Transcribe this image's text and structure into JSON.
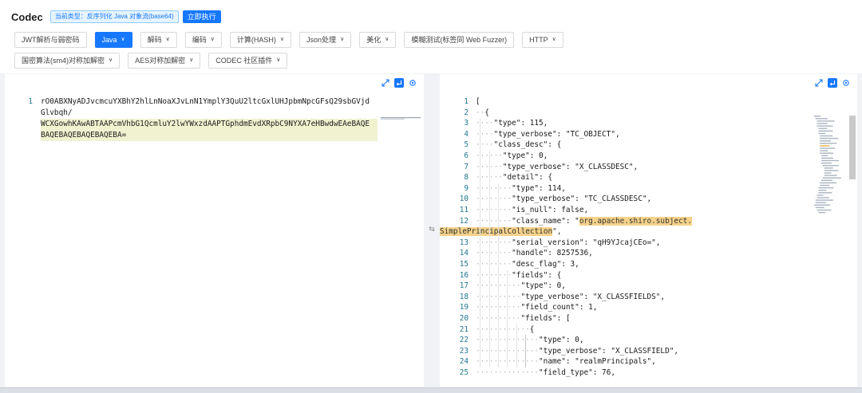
{
  "header": {
    "title": "Codec",
    "mode_tag": "当前类型：反序列化 Java 对象流(base64)",
    "run_label": "立即执行"
  },
  "toolbar": {
    "row1": [
      {
        "label": "JWT解析与弱密码",
        "dropdown": false,
        "active": false
      },
      {
        "label": "Java",
        "dropdown": true,
        "active": true
      },
      {
        "label": "解码",
        "dropdown": true,
        "active": false
      },
      {
        "label": "编码",
        "dropdown": true,
        "active": false
      },
      {
        "label": "计算(HASH)",
        "dropdown": true,
        "active": false
      },
      {
        "label": "Json处理",
        "dropdown": true,
        "active": false
      },
      {
        "label": "美化",
        "dropdown": true,
        "active": false
      },
      {
        "label": "模糊测试(标签同 Web Fuzzer)",
        "dropdown": false,
        "active": false
      },
      {
        "label": "HTTP",
        "dropdown": true,
        "active": false
      }
    ],
    "row2": [
      {
        "label": "国密算法(sm4)对称加解密",
        "dropdown": true,
        "active": false
      },
      {
        "label": "AES对称加解密",
        "dropdown": true,
        "active": false
      },
      {
        "label": "CODEC 社区插件",
        "dropdown": true,
        "active": false
      }
    ]
  },
  "input_editor": {
    "line_number": "1",
    "lines": [
      "rO0ABXNyADJvcmcuYXBhY2hlLnNoaXJvLnN1YmplY3QuU2ltcGxlUHJpbmNpcGFsQ29sbGVjd",
      "Glvbqh/",
      "WCXGowhKAwABTAAPcmVhbG1QcmluY2lwYWxzdAAPTGphdmEvdXRpbC9NYXA7eHBwdwEAeBAQE",
      "BAQEBAQEBAQEBAQEBA="
    ]
  },
  "output_editor": {
    "lines": [
      {
        "n": "1",
        "indent": 0,
        "text": "["
      },
      {
        "n": "2",
        "indent": 1,
        "text": "{"
      },
      {
        "n": "3",
        "indent": 2,
        "text": "\"type\": 115,"
      },
      {
        "n": "4",
        "indent": 2,
        "text": "\"type_verbose\": \"TC_OBJECT\","
      },
      {
        "n": "5",
        "indent": 2,
        "text": "\"class_desc\": {"
      },
      {
        "n": "6",
        "indent": 3,
        "text": "\"type\": 0,"
      },
      {
        "n": "7",
        "indent": 3,
        "text": "\"type_verbose\": \"X_CLASSDESC\","
      },
      {
        "n": "8",
        "indent": 3,
        "text": "\"detail\": {"
      },
      {
        "n": "9",
        "indent": 4,
        "text": "\"type\": 114,"
      },
      {
        "n": "10",
        "indent": 4,
        "text": "\"type_verbose\": \"TC_CLASSDESC\","
      },
      {
        "n": "11",
        "indent": 4,
        "text": "\"is_null\": false,"
      },
      {
        "n": "12",
        "indent": 4,
        "text": "\"class_name\": \"",
        "sel": "org.apache.shiro.subject."
      },
      {
        "n": "",
        "indent": 0,
        "text": "",
        "sel": "SimplePrincipalCollection",
        "tail": "\","
      },
      {
        "n": "13",
        "indent": 4,
        "text": "\"serial_version\": \"qH9YJcajCEo=\","
      },
      {
        "n": "14",
        "indent": 4,
        "text": "\"handle\": 8257536,"
      },
      {
        "n": "15",
        "indent": 4,
        "text": "\"desc_flag\": 3,"
      },
      {
        "n": "16",
        "indent": 4,
        "text": "\"fields\": {"
      },
      {
        "n": "17",
        "indent": 5,
        "text": "\"type\": 0,"
      },
      {
        "n": "18",
        "indent": 5,
        "text": "\"type_verbose\": \"X_CLASSFIELDS\","
      },
      {
        "n": "19",
        "indent": 5,
        "text": "\"field_count\": 1,"
      },
      {
        "n": "20",
        "indent": 5,
        "text": "\"fields\": ["
      },
      {
        "n": "21",
        "indent": 6,
        "text": "{"
      },
      {
        "n": "22",
        "indent": 7,
        "text": "\"type\": 0,"
      },
      {
        "n": "23",
        "indent": 7,
        "text": "\"type_verbose\": \"X_CLASSFIELD\","
      },
      {
        "n": "24",
        "indent": 7,
        "text": "\"name\": \"realmPrincipals\","
      },
      {
        "n": "25",
        "indent": 7,
        "text": "\"field_type\": 76,"
      }
    ]
  },
  "colors": {
    "accent": "#1677ff",
    "highlight_line": "#f0f2d0",
    "selection": "#f5d28a",
    "line_number": "#237893"
  },
  "icons": {
    "expand": "expand-arrows-icon",
    "wrap": "word-wrap-icon",
    "settings": "gear-icon",
    "swap": "swap-arrows-icon"
  }
}
